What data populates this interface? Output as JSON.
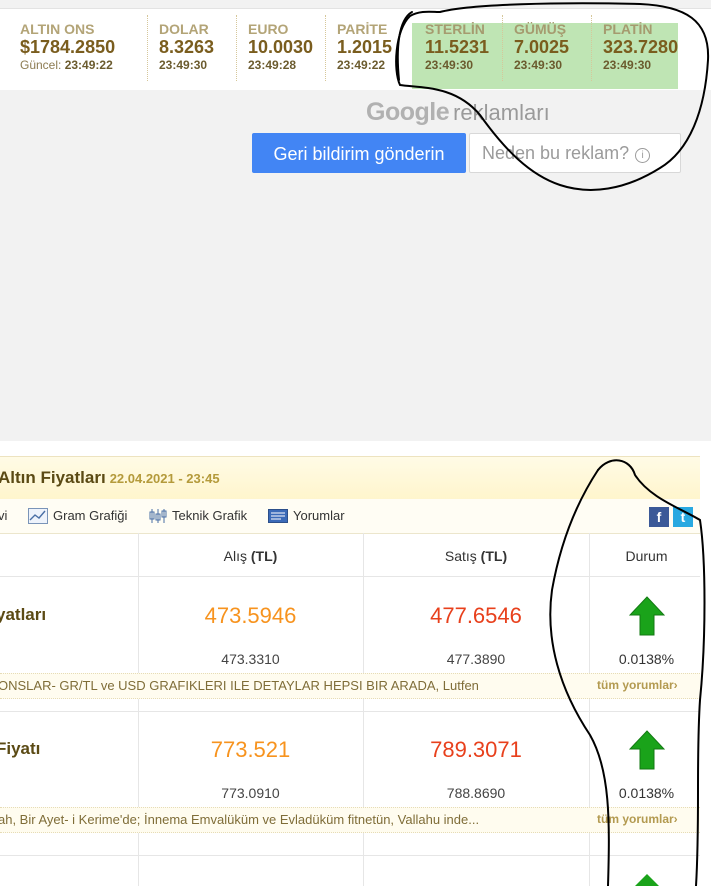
{
  "ticker": [
    {
      "name": "ALTIN ONS",
      "value": "$1784.2850",
      "time_label": "Güncel:",
      "time": "23:49:22"
    },
    {
      "name": "DOLAR",
      "value": "8.3263",
      "time_label": "",
      "time": "23:49:30"
    },
    {
      "name": "EURO",
      "value": "10.0030",
      "time_label": "",
      "time": "23:49:28"
    },
    {
      "name": "PARİTE",
      "value": "1.2015",
      "time_label": "",
      "time": "23:49:22"
    },
    {
      "name": "STERLİN",
      "value": "11.5231",
      "time_label": "",
      "time": "23:49:30"
    },
    {
      "name": "GÜMÜŞ",
      "value": "7.0025",
      "time_label": "",
      "time": "23:49:30"
    },
    {
      "name": "PLATİN",
      "value": "323.7280",
      "time_label": "",
      "time": "23:49:30"
    }
  ],
  "ad": {
    "google_logo": "Google",
    "google_text": "reklamları",
    "feedback_button": "Geri bildirim gönderin",
    "why_button": "Neden bu reklam?",
    "info_glyph": "i"
  },
  "panel": {
    "title": "Altın Fiyatları",
    "date": "22.04.2021 - 23:45",
    "toolbar": {
      "cut_item": "vi",
      "gram_chart": "Gram Grafiği",
      "tech_chart": "Teknik Grafik",
      "comments": "Yorumlar"
    },
    "share": {
      "facebook": "f",
      "twitter": "t"
    },
    "columns": {
      "buy": "Alış",
      "buy_unit": "(TL)",
      "sell": "Satış",
      "sell_unit": "(TL)",
      "status": "Durum"
    },
    "rows": [
      {
        "title": "yatları",
        "buy": "473.5946",
        "sell": "477.6546",
        "buy_prev": "473.3310",
        "sell_prev": "477.3890",
        "change": "0.0138%",
        "trend_icon": "up-arrow-icon",
        "comment": "ONSLAR- GR/TL ve USD GRAFIKLERI ILE DETAYLAR HEPSI BIR ARADA, Lutfen",
        "comment_link": "tüm yorumlar›"
      },
      {
        "title": "Fiyatı",
        "buy": "773.521",
        "sell": "789.3071",
        "buy_prev": "773.0910",
        "sell_prev": "788.8690",
        "change": "0.0138%",
        "trend_icon": "up-arrow-icon",
        "comment": "ah, Bir Ayet- i Kerime'de; İnnema Emvalüküm ve Evladüküm fitnetün, Vallahu inde...",
        "comment_link": "tüm yorumlar›"
      }
    ]
  },
  "colors": {
    "green_highlight": "#bfe5b4",
    "google_blue": "#4285f4",
    "buy": "#f7931e",
    "sell": "#e8401c",
    "arrow": "#1aa31a"
  }
}
